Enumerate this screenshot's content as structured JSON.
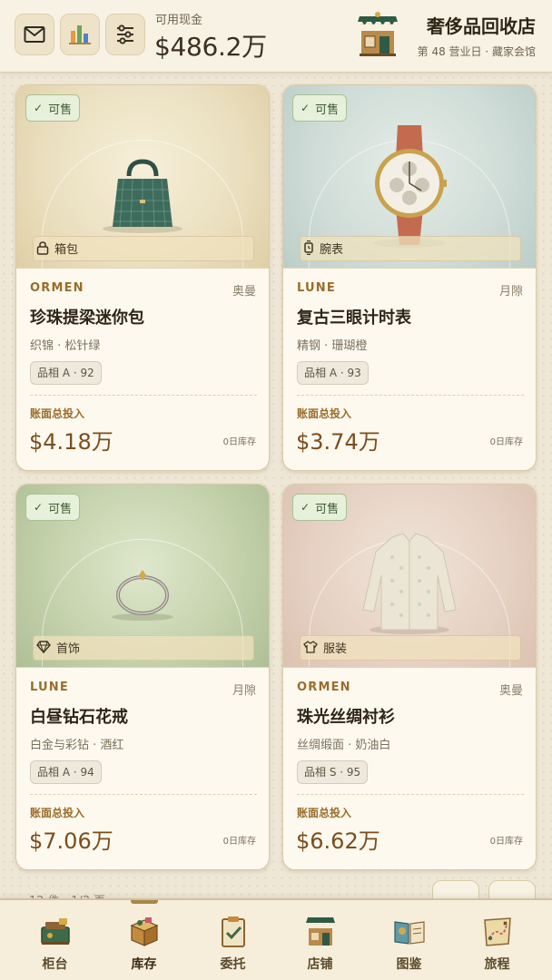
{
  "header": {
    "cash_label": "可用现金",
    "cash_value": "$486.2万",
    "shop_name": "奢侈品回收店",
    "shop_subtitle": "第 48 营业日 · 藏家会馆",
    "buttons": [
      {
        "icon": "mail-icon"
      },
      {
        "icon": "bar-chart-icon"
      },
      {
        "icon": "sliders-icon"
      }
    ]
  },
  "cards": [
    {
      "badge": "可售",
      "category": "箱包",
      "category_icon": "lock-icon",
      "brand": "ORMEN",
      "brand_cn": "奥曼",
      "name": "珍珠提梁迷你包",
      "material": "织锦 · 松针绿",
      "grade": "品相 A · 92",
      "cost_label": "账面总投入",
      "cost_value": "$4.18万",
      "stock": "0日库存"
    },
    {
      "badge": "可售",
      "category": "腕表",
      "category_icon": "watch-icon",
      "brand": "LUNE",
      "brand_cn": "月隙",
      "name": "复古三眼计时表",
      "material": "精钢 · 珊瑚橙",
      "grade": "品相 A · 93",
      "cost_label": "账面总投入",
      "cost_value": "$3.74万",
      "stock": "0日库存"
    },
    {
      "badge": "可售",
      "category": "首饰",
      "category_icon": "diamond-icon",
      "brand": "LUNE",
      "brand_cn": "月隙",
      "name": "白昼钻石花戒",
      "material": "白金与彩钻 · 酒红",
      "grade": "品相 A · 94",
      "cost_label": "账面总投入",
      "cost_value": "$7.06万",
      "stock": "0日库存"
    },
    {
      "badge": "可售",
      "category": "服装",
      "category_icon": "shirt-icon",
      "brand": "ORMEN",
      "brand_cn": "奥曼",
      "name": "珠光丝绸衬衫",
      "material": "丝绸缎面 · 奶油白",
      "grade": "品相 S · 95",
      "cost_label": "账面总投入",
      "cost_value": "$6.62万",
      "stock": "0日库存"
    }
  ],
  "pagination": {
    "text": "12 件 · 1/3 页"
  },
  "nav": [
    {
      "label": "柜台",
      "icon": "counter-icon"
    },
    {
      "label": "库存",
      "icon": "box-icon",
      "active": true
    },
    {
      "label": "委托",
      "icon": "clipboard-icon"
    },
    {
      "label": "店铺",
      "icon": "shop-icon"
    },
    {
      "label": "图鉴",
      "icon": "book-icon"
    },
    {
      "label": "旅程",
      "icon": "map-icon"
    }
  ],
  "colors": {
    "accent": "#9a6d2a",
    "price": "#7a4e1d",
    "badge_bg": "#e7f0da",
    "shop_green": "#2f5a43"
  }
}
